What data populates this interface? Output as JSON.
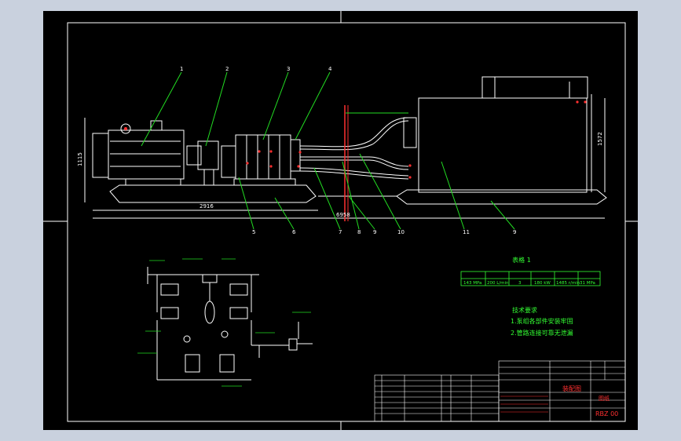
{
  "colors": {
    "frame_bg": "#c9d1de",
    "canvas": "#000000",
    "line": "#ffffff",
    "leader": "#22dd22",
    "accent": "#ff3030",
    "text_green": "#33ff33"
  },
  "dimensions": {
    "height_left": "1115",
    "length_bottom": "2916",
    "length_total": "6958",
    "height_right": "1572"
  },
  "callouts": {
    "top": [
      "1",
      "2",
      "3",
      "4"
    ],
    "bottom": [
      "5",
      "6",
      "7",
      "8",
      "9",
      "10",
      "11",
      "9"
    ]
  },
  "table": {
    "heading": "表格 1",
    "values": [
      "143 MPa",
      "200 L/min",
      "3",
      "180 kW",
      "1485 r/min",
      "31 MPa"
    ]
  },
  "notes": {
    "heading": "技术要求",
    "line1": "1.泵组各部件安装牢固",
    "line2": "2.管路连接可靠无泄漏"
  },
  "title_block": {
    "drawing_name": "装配图",
    "sheet_label": "图纸",
    "drawing_code": "RBZ 00"
  }
}
